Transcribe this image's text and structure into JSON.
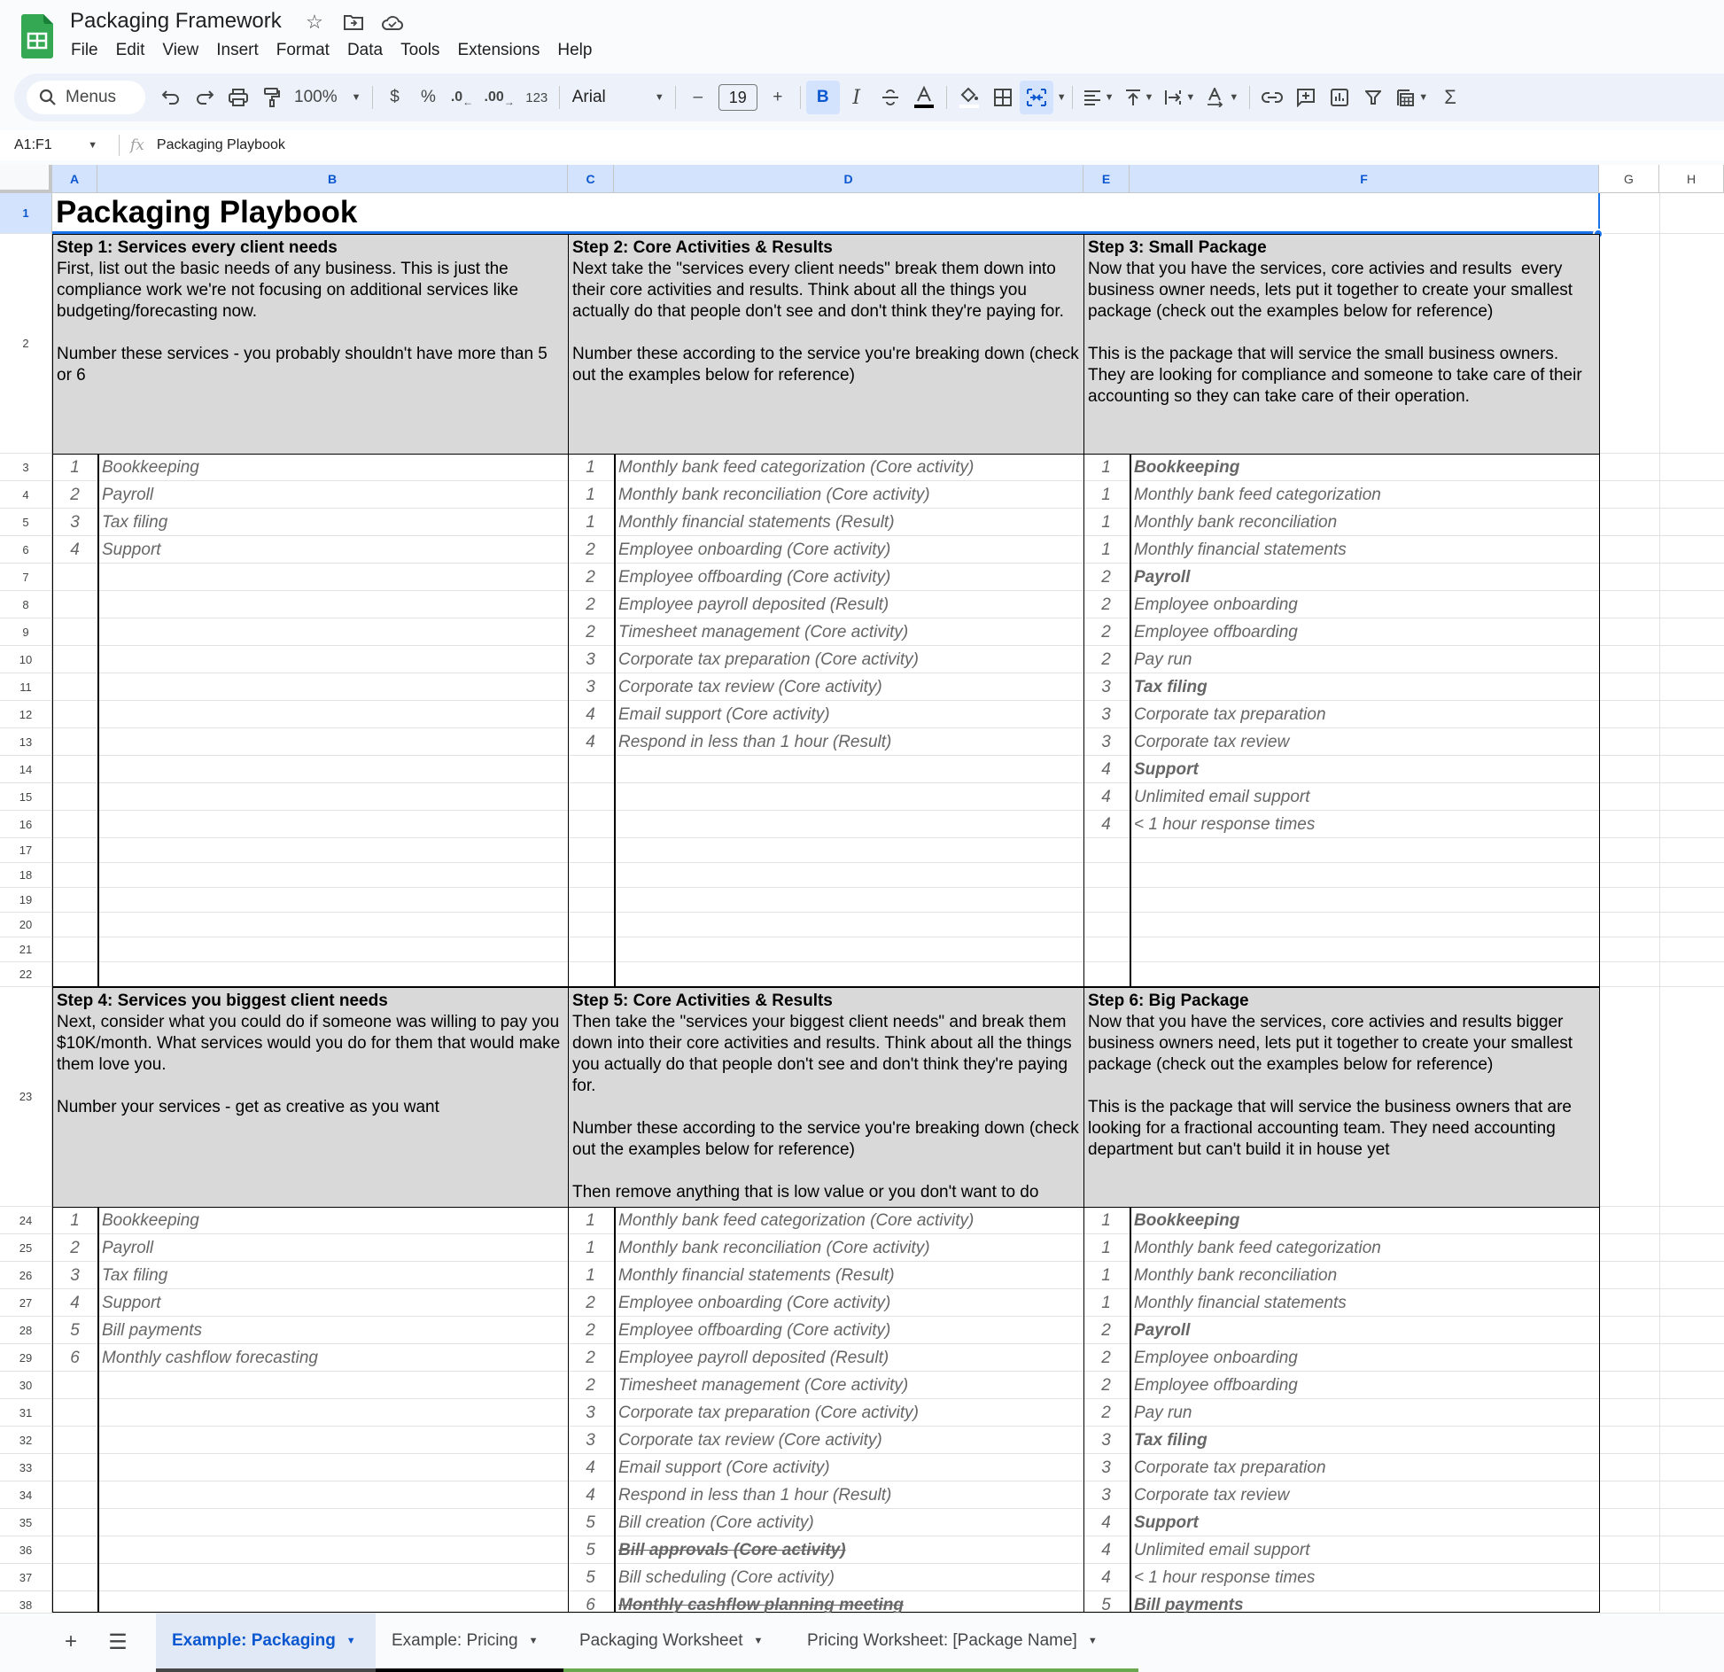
{
  "app": {
    "doc_title": "Packaging Framework",
    "menu": [
      "File",
      "Edit",
      "View",
      "Insert",
      "Format",
      "Data",
      "Tools",
      "Extensions",
      "Help"
    ]
  },
  "toolbar": {
    "search_label": "Menus",
    "zoom": "100%",
    "currency": "$",
    "percent": "%",
    "dec_decrease": ".0",
    "dec_increase": ".00",
    "number_format": "123",
    "font": "Arial",
    "font_size": "19",
    "minus": "–",
    "plus": "+"
  },
  "formula_bar": {
    "name_box": "A1:F1",
    "fx": "fx",
    "value": "Packaging Playbook"
  },
  "columns": [
    "A",
    "B",
    "C",
    "D",
    "E",
    "F",
    "G",
    "H"
  ],
  "rows": [
    "1",
    "2",
    "3",
    "4",
    "5",
    "6",
    "7",
    "8",
    "9",
    "10",
    "11",
    "12",
    "13",
    "14",
    "15",
    "16",
    "17",
    "18",
    "19",
    "20",
    "21",
    "22",
    "23",
    "24",
    "25",
    "26",
    "27",
    "28",
    "29",
    "30",
    "31",
    "32",
    "33",
    "34",
    "35",
    "36",
    "37",
    "38"
  ],
  "sheet": {
    "title": "Packaging Playbook",
    "steps": [
      {
        "title": "Step 1: Services every client needs",
        "body": "First, list out the basic needs of any business. This is just the compliance work we're not focusing on additional services like budgeting/forecasting now.\n\nNumber these services - you probably shouldn't have more than 5 or 6"
      },
      {
        "title": "Step 2: Core Activities & Results",
        "body": "Next take the \"services every client needs\" break them down into their core activities and results. Think about all the things you actually do that people don't see and don't think they're paying for.\n\nNumber these according to the service you're breaking down (check out the examples below for reference)"
      },
      {
        "title": "Step 3: Small Package",
        "body": "Now that you have the services, core activies and results  every business owner needs, lets put it together to create your smallest package (check out the examples below for reference)\n\nThis is the package that will service the small business owners. They are looking for compliance and someone to take care of their accounting so they can take care of their operation."
      },
      {
        "title": "Step 4: Services you biggest client needs",
        "body": "Next, consider what you could do if someone was willing to pay you $10K/month. What services would you do for them that would make them love you.\n\nNumber your services - get as creative as you want"
      },
      {
        "title": "Step 5: Core Activities & Results",
        "body": "Then take the \"services your biggest client needs\" and break them down into their core activities and results. Think about all the things you actually do that people don't see and don't think they're paying for.\n\nNumber these according to the service you're breaking down (check out the examples below for reference)\n\nThen remove anything that is low value or you don't want to do"
      },
      {
        "title": "Step 6: Big Package",
        "body": "Now that you have the services, core activies and results bigger business owners need, lets put it together to create your smallest package (check out the examples below for reference)\n\nThis is the package that will service the business owners that are looking for a fractional accounting team. They need accounting department but can't build it in house yet"
      }
    ],
    "section1": {
      "services": [
        {
          "n": "1",
          "t": "Bookkeeping"
        },
        {
          "n": "2",
          "t": "Payroll"
        },
        {
          "n": "3",
          "t": "Tax filing"
        },
        {
          "n": "4",
          "t": "Support"
        }
      ],
      "activities": [
        {
          "n": "1",
          "t": "Monthly bank feed categorization (Core activity)"
        },
        {
          "n": "1",
          "t": "Monthly bank reconciliation (Core activity)"
        },
        {
          "n": "1",
          "t": "Monthly financial statements (Result)"
        },
        {
          "n": "2",
          "t": "Employee onboarding (Core activity)"
        },
        {
          "n": "2",
          "t": "Employee offboarding (Core activity)"
        },
        {
          "n": "2",
          "t": "Employee payroll deposited (Result)"
        },
        {
          "n": "2",
          "t": "Timesheet management (Core activity)"
        },
        {
          "n": "3",
          "t": "Corporate tax preparation (Core activity)"
        },
        {
          "n": "3",
          "t": "Corporate tax review (Core activity)"
        },
        {
          "n": "4",
          "t": "Email support (Core activity)"
        },
        {
          "n": "4",
          "t": "Respond in less than 1 hour (Result)"
        }
      ],
      "package": [
        {
          "n": "1",
          "t": "Bookkeeping",
          "style": "bold"
        },
        {
          "n": "1",
          "t": "Monthly bank feed categorization"
        },
        {
          "n": "1",
          "t": "Monthly bank reconciliation"
        },
        {
          "n": "1",
          "t": "Monthly financial statements"
        },
        {
          "n": "2",
          "t": "Payroll",
          "style": "bold"
        },
        {
          "n": "2",
          "t": "Employee onboarding"
        },
        {
          "n": "2",
          "t": "Employee offboarding"
        },
        {
          "n": "2",
          "t": "Pay run"
        },
        {
          "n": "3",
          "t": "Tax filing",
          "style": "bold"
        },
        {
          "n": "3",
          "t": "Corporate tax preparation"
        },
        {
          "n": "3",
          "t": "Corporate tax review"
        },
        {
          "n": "4",
          "t": "Support",
          "style": "bold"
        },
        {
          "n": "4",
          "t": "Unlimited email support"
        },
        {
          "n": "4",
          "t": "< 1 hour response times"
        }
      ]
    },
    "section2": {
      "services": [
        {
          "n": "1",
          "t": "Bookkeeping"
        },
        {
          "n": "2",
          "t": "Payroll"
        },
        {
          "n": "3",
          "t": "Tax filing"
        },
        {
          "n": "4",
          "t": "Support"
        },
        {
          "n": "5",
          "t": "Bill payments"
        },
        {
          "n": "6",
          "t": "Monthly cashflow forecasting"
        }
      ],
      "activities": [
        {
          "n": "1",
          "t": "Monthly bank feed categorization (Core activity)"
        },
        {
          "n": "1",
          "t": "Monthly bank reconciliation (Core activity)"
        },
        {
          "n": "1",
          "t": "Monthly financial statements (Result)"
        },
        {
          "n": "2",
          "t": "Employee onboarding (Core activity)"
        },
        {
          "n": "2",
          "t": "Employee offboarding (Core activity)"
        },
        {
          "n": "2",
          "t": "Employee payroll deposited (Result)"
        },
        {
          "n": "2",
          "t": "Timesheet management (Core activity)"
        },
        {
          "n": "3",
          "t": "Corporate tax preparation (Core activity)"
        },
        {
          "n": "3",
          "t": "Corporate tax review (Core activity)"
        },
        {
          "n": "4",
          "t": "Email support (Core activity)"
        },
        {
          "n": "4",
          "t": "Respond in less than 1 hour (Result)"
        },
        {
          "n": "5",
          "t": "Bill creation (Core activity)"
        },
        {
          "n": "5",
          "t": "Bill approvals (Core activity)",
          "style": "strike"
        },
        {
          "n": "5",
          "t": "Bill scheduling (Core activity)"
        },
        {
          "n": "6",
          "t": "Monthly cashflow planning meeting",
          "style": "strike"
        }
      ],
      "package": [
        {
          "n": "1",
          "t": "Bookkeeping",
          "style": "bold"
        },
        {
          "n": "1",
          "t": "Monthly bank feed categorization"
        },
        {
          "n": "1",
          "t": "Monthly bank reconciliation"
        },
        {
          "n": "1",
          "t": "Monthly financial statements"
        },
        {
          "n": "2",
          "t": "Payroll",
          "style": "bold"
        },
        {
          "n": "2",
          "t": "Employee onboarding"
        },
        {
          "n": "2",
          "t": "Employee offboarding"
        },
        {
          "n": "2",
          "t": "Pay run"
        },
        {
          "n": "3",
          "t": "Tax filing",
          "style": "bold"
        },
        {
          "n": "3",
          "t": "Corporate tax preparation"
        },
        {
          "n": "3",
          "t": "Corporate tax review"
        },
        {
          "n": "4",
          "t": "Support",
          "style": "bold"
        },
        {
          "n": "4",
          "t": "Unlimited email support"
        },
        {
          "n": "4",
          "t": "< 1 hour response times"
        },
        {
          "n": "5",
          "t": "Bill payments",
          "style": "bold"
        }
      ]
    }
  },
  "tabs": [
    {
      "label": "Example: Packaging",
      "active": true,
      "color": "#444746"
    },
    {
      "label": "Example: Pricing",
      "active": false,
      "color": "#000000"
    },
    {
      "label": "Packaging Worksheet",
      "active": false,
      "color": "#6aa84f"
    },
    {
      "label": "Pricing Worksheet: [Package Name]",
      "active": false,
      "color": "#6aa84f"
    }
  ],
  "colors": {
    "accent": "#0b57d0",
    "instruction_fill": "#d9d9d9",
    "selection": "#1a73e8",
    "logo_green": "#34a853"
  }
}
